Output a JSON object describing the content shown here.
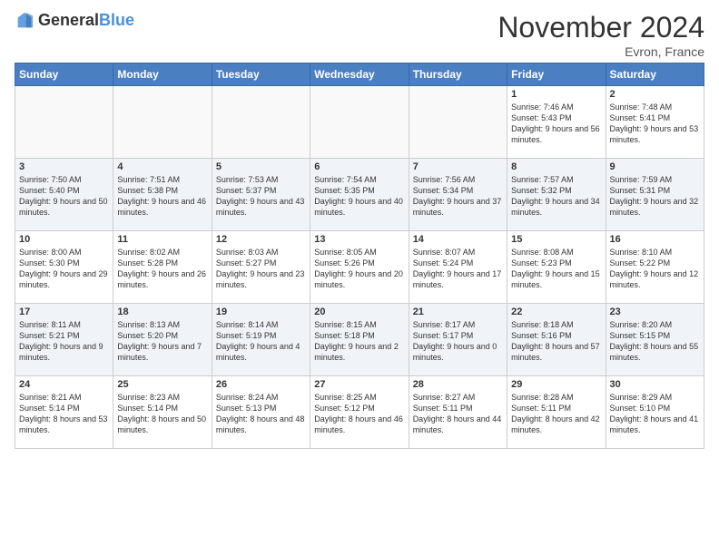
{
  "header": {
    "logo_general": "General",
    "logo_blue": "Blue",
    "title": "November 2024",
    "location": "Evron, France"
  },
  "days_of_week": [
    "Sunday",
    "Monday",
    "Tuesday",
    "Wednesday",
    "Thursday",
    "Friday",
    "Saturday"
  ],
  "weeks": [
    [
      {
        "day": "",
        "sunrise": "",
        "sunset": "",
        "daylight": ""
      },
      {
        "day": "",
        "sunrise": "",
        "sunset": "",
        "daylight": ""
      },
      {
        "day": "",
        "sunrise": "",
        "sunset": "",
        "daylight": ""
      },
      {
        "day": "",
        "sunrise": "",
        "sunset": "",
        "daylight": ""
      },
      {
        "day": "",
        "sunrise": "",
        "sunset": "",
        "daylight": ""
      },
      {
        "day": "1",
        "sunrise": "Sunrise: 7:46 AM",
        "sunset": "Sunset: 5:43 PM",
        "daylight": "Daylight: 9 hours and 56 minutes."
      },
      {
        "day": "2",
        "sunrise": "Sunrise: 7:48 AM",
        "sunset": "Sunset: 5:41 PM",
        "daylight": "Daylight: 9 hours and 53 minutes."
      }
    ],
    [
      {
        "day": "3",
        "sunrise": "Sunrise: 7:50 AM",
        "sunset": "Sunset: 5:40 PM",
        "daylight": "Daylight: 9 hours and 50 minutes."
      },
      {
        "day": "4",
        "sunrise": "Sunrise: 7:51 AM",
        "sunset": "Sunset: 5:38 PM",
        "daylight": "Daylight: 9 hours and 46 minutes."
      },
      {
        "day": "5",
        "sunrise": "Sunrise: 7:53 AM",
        "sunset": "Sunset: 5:37 PM",
        "daylight": "Daylight: 9 hours and 43 minutes."
      },
      {
        "day": "6",
        "sunrise": "Sunrise: 7:54 AM",
        "sunset": "Sunset: 5:35 PM",
        "daylight": "Daylight: 9 hours and 40 minutes."
      },
      {
        "day": "7",
        "sunrise": "Sunrise: 7:56 AM",
        "sunset": "Sunset: 5:34 PM",
        "daylight": "Daylight: 9 hours and 37 minutes."
      },
      {
        "day": "8",
        "sunrise": "Sunrise: 7:57 AM",
        "sunset": "Sunset: 5:32 PM",
        "daylight": "Daylight: 9 hours and 34 minutes."
      },
      {
        "day": "9",
        "sunrise": "Sunrise: 7:59 AM",
        "sunset": "Sunset: 5:31 PM",
        "daylight": "Daylight: 9 hours and 32 minutes."
      }
    ],
    [
      {
        "day": "10",
        "sunrise": "Sunrise: 8:00 AM",
        "sunset": "Sunset: 5:30 PM",
        "daylight": "Daylight: 9 hours and 29 minutes."
      },
      {
        "day": "11",
        "sunrise": "Sunrise: 8:02 AM",
        "sunset": "Sunset: 5:28 PM",
        "daylight": "Daylight: 9 hours and 26 minutes."
      },
      {
        "day": "12",
        "sunrise": "Sunrise: 8:03 AM",
        "sunset": "Sunset: 5:27 PM",
        "daylight": "Daylight: 9 hours and 23 minutes."
      },
      {
        "day": "13",
        "sunrise": "Sunrise: 8:05 AM",
        "sunset": "Sunset: 5:26 PM",
        "daylight": "Daylight: 9 hours and 20 minutes."
      },
      {
        "day": "14",
        "sunrise": "Sunrise: 8:07 AM",
        "sunset": "Sunset: 5:24 PM",
        "daylight": "Daylight: 9 hours and 17 minutes."
      },
      {
        "day": "15",
        "sunrise": "Sunrise: 8:08 AM",
        "sunset": "Sunset: 5:23 PM",
        "daylight": "Daylight: 9 hours and 15 minutes."
      },
      {
        "day": "16",
        "sunrise": "Sunrise: 8:10 AM",
        "sunset": "Sunset: 5:22 PM",
        "daylight": "Daylight: 9 hours and 12 minutes."
      }
    ],
    [
      {
        "day": "17",
        "sunrise": "Sunrise: 8:11 AM",
        "sunset": "Sunset: 5:21 PM",
        "daylight": "Daylight: 9 hours and 9 minutes."
      },
      {
        "day": "18",
        "sunrise": "Sunrise: 8:13 AM",
        "sunset": "Sunset: 5:20 PM",
        "daylight": "Daylight: 9 hours and 7 minutes."
      },
      {
        "day": "19",
        "sunrise": "Sunrise: 8:14 AM",
        "sunset": "Sunset: 5:19 PM",
        "daylight": "Daylight: 9 hours and 4 minutes."
      },
      {
        "day": "20",
        "sunrise": "Sunrise: 8:15 AM",
        "sunset": "Sunset: 5:18 PM",
        "daylight": "Daylight: 9 hours and 2 minutes."
      },
      {
        "day": "21",
        "sunrise": "Sunrise: 8:17 AM",
        "sunset": "Sunset: 5:17 PM",
        "daylight": "Daylight: 9 hours and 0 minutes."
      },
      {
        "day": "22",
        "sunrise": "Sunrise: 8:18 AM",
        "sunset": "Sunset: 5:16 PM",
        "daylight": "Daylight: 8 hours and 57 minutes."
      },
      {
        "day": "23",
        "sunrise": "Sunrise: 8:20 AM",
        "sunset": "Sunset: 5:15 PM",
        "daylight": "Daylight: 8 hours and 55 minutes."
      }
    ],
    [
      {
        "day": "24",
        "sunrise": "Sunrise: 8:21 AM",
        "sunset": "Sunset: 5:14 PM",
        "daylight": "Daylight: 8 hours and 53 minutes."
      },
      {
        "day": "25",
        "sunrise": "Sunrise: 8:23 AM",
        "sunset": "Sunset: 5:14 PM",
        "daylight": "Daylight: 8 hours and 50 minutes."
      },
      {
        "day": "26",
        "sunrise": "Sunrise: 8:24 AM",
        "sunset": "Sunset: 5:13 PM",
        "daylight": "Daylight: 8 hours and 48 minutes."
      },
      {
        "day": "27",
        "sunrise": "Sunrise: 8:25 AM",
        "sunset": "Sunset: 5:12 PM",
        "daylight": "Daylight: 8 hours and 46 minutes."
      },
      {
        "day": "28",
        "sunrise": "Sunrise: 8:27 AM",
        "sunset": "Sunset: 5:11 PM",
        "daylight": "Daylight: 8 hours and 44 minutes."
      },
      {
        "day": "29",
        "sunrise": "Sunrise: 8:28 AM",
        "sunset": "Sunset: 5:11 PM",
        "daylight": "Daylight: 8 hours and 42 minutes."
      },
      {
        "day": "30",
        "sunrise": "Sunrise: 8:29 AM",
        "sunset": "Sunset: 5:10 PM",
        "daylight": "Daylight: 8 hours and 41 minutes."
      }
    ]
  ]
}
